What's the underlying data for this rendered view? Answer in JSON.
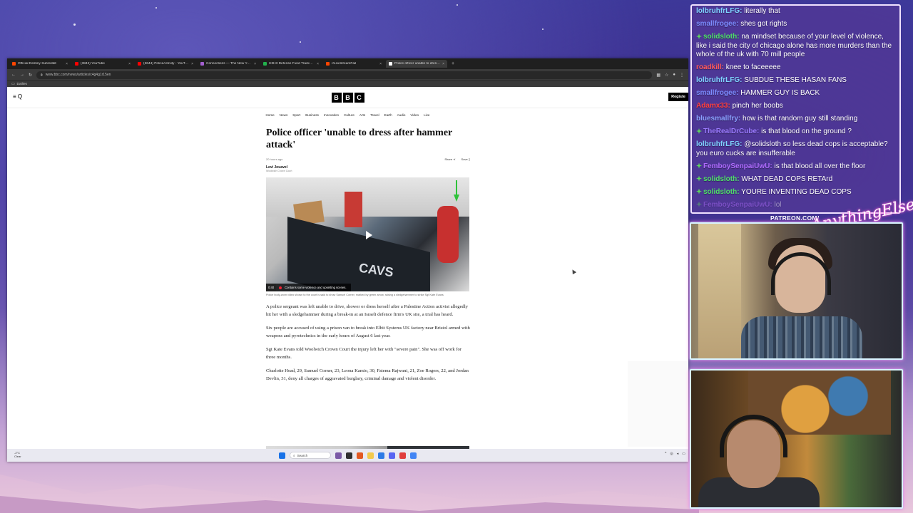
{
  "browser": {
    "tabs": [
      {
        "label": "Official Destiny Subreddit",
        "color": "#ff4500",
        "active": false
      },
      {
        "label": "(3842) YouTube",
        "color": "#ff0000",
        "active": false
      },
      {
        "label": "(3644) PoliceActivity - YouTube",
        "color": "#ff0000",
        "active": false
      },
      {
        "label": "Connections — The New York T",
        "color": "#a35fd0",
        "active": false
      },
      {
        "label": "H3H3 Defense Fund Tracker - S",
        "color": "#22b14c",
        "active": false
      },
      {
        "label": "r/LivestreamFail",
        "color": "#ff4500",
        "active": false
      },
      {
        "label": "Police officer unable to dress a",
        "color": "#ffffff",
        "active": true
      }
    ],
    "url": "www.bbc.com/news/articles/c4g4g1r15en",
    "bookmark": "Dailies"
  },
  "bbc": {
    "logo": [
      "B",
      "B",
      "C"
    ],
    "menu_label": "≡ Q",
    "register": "Registe",
    "nav": [
      "Home",
      "News",
      "Sport",
      "Business",
      "Innovation",
      "Culture",
      "Arts",
      "Travel",
      "Earth",
      "Audio",
      "Video",
      "Live"
    ]
  },
  "article": {
    "headline": "Police officer 'unable to dress after hammer attack'",
    "time": "20 hours ago",
    "share": "Share",
    "save": "Save",
    "author": "Levi Jouavel",
    "author_role": "Woolwich Crown Court",
    "video_duration": "0:40",
    "video_warning": "Contains some violence and upsetting scenes.",
    "video_overlay_text": "CAVS",
    "caption": "Police body-worn video shown to the court is said to show Samuel Corner, marked by green arrow, raising a sledgehammer to strike Sgt Kate Evans",
    "paragraphs": [
      "A police sergeant was left unable to drive, shower or dress herself after a Palestine Action activist allegedly hit her with a sledgehammer during a break-in at an Israeli defence firm's UK site, a trial has heard.",
      "Six people are accused of using a prison van to break into Elbit Systems UK factory near Bristol armed with weapons and pyrotechnics in the early hours of August 6 last year.",
      "Sgt Kate Evans told Woolwich Crown Court the injury left her with \"severe pain\". She was off work for three months.",
      "Charlotte Head, 29, Samuel Corner, 23, Leona Kamio, 30, Fatema Rajwani, 21, Zoe Rogers, 22, and Jordan Devlin, 31, deny all charges of aggravated burglary, criminal damage and violent disorder."
    ]
  },
  "taskbar": {
    "weather_temp": "-2°C",
    "weather_desc": "Clear",
    "search": "Search"
  },
  "chat": {
    "messages": [
      {
        "user": "lolbruhfrLFG:",
        "text": "literally that",
        "color": "#7fd3ff",
        "badge": false
      },
      {
        "user": "smallfrogee:",
        "text": "shes got rights",
        "color": "#7c8cff",
        "badge": false
      },
      {
        "user": "solidsloth:",
        "text": "na mindset because of your level of violence, like i said the city of chicago alone has more murders than the whole of the uk with 70 mill people",
        "color": "#4fe06a",
        "badge": true
      },
      {
        "user": "roadkill:",
        "text": "knee to faceeeee",
        "color": "#ff5a5a",
        "badge": false
      },
      {
        "user": "lolbruhfrLFG:",
        "text": "SUBDUE THESE HASAN FANS",
        "color": "#7fd3ff",
        "badge": false
      },
      {
        "user": "smallfrogee:",
        "text": "HAMMER GUY IS BACK",
        "color": "#7c8cff",
        "badge": false
      },
      {
        "user": "Adamx33:",
        "text": "pinch her boobs",
        "color": "#ff3f3f",
        "badge": false
      },
      {
        "user": "bluesmallfry:",
        "text": "how is that random guy still standing",
        "color": "#8aa0ff",
        "badge": false
      },
      {
        "user": "TheRealDrCube:",
        "text": "is that blood on the ground ?",
        "color": "#9b7bff",
        "badge": true
      },
      {
        "user": "lolbruhfrLFG:",
        "text": "@solidsloth so less dead cops is acceptable? you euro cucks are insufferable",
        "color": "#7fd3ff",
        "badge": false
      },
      {
        "user": "FemboySenpaiUwU:",
        "text": "is that blood all over the floor",
        "color": "#b06cff",
        "badge": true
      },
      {
        "user": "solidsloth:",
        "text": "WHAT DEAD COPS RETArd",
        "color": "#4fe06a",
        "badge": true
      },
      {
        "user": "solidsloth:",
        "text": "YOURE INVENTING DEAD COPS",
        "color": "#4fe06a",
        "badge": true
      },
      {
        "user": "FemboySenpaiUwU:",
        "text": "lol",
        "color": "#b06cff",
        "badge": true
      }
    ]
  },
  "overlay": {
    "patreon": "PATREON.COM/",
    "brand": "AnythingElse"
  }
}
